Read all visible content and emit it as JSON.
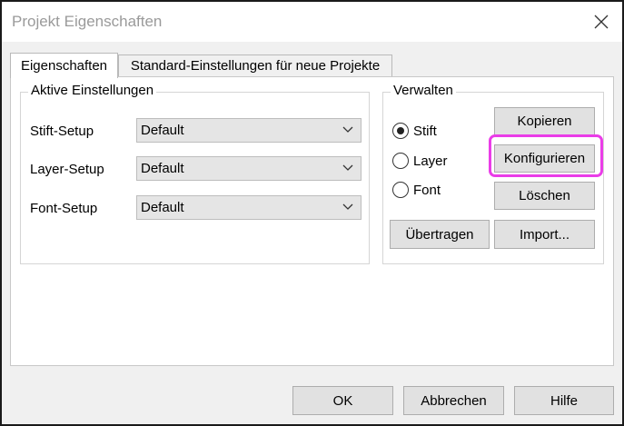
{
  "window": {
    "title": "Projekt Eigenschaften",
    "highlight_color": "#ea3de8"
  },
  "tabs": [
    {
      "label": "Eigenschaften",
      "active": true
    },
    {
      "label": "Standard-Einstellungen für neue Projekte",
      "active": false
    }
  ],
  "active_settings": {
    "title": "Aktive Einstellungen",
    "rows": [
      {
        "label": "Stift-Setup",
        "value": "Default"
      },
      {
        "label": "Layer-Setup",
        "value": "Default"
      },
      {
        "label": "Font-Setup",
        "value": "Default"
      }
    ]
  },
  "manage": {
    "title": "Verwalten",
    "radios": [
      {
        "label": "Stift",
        "selected": true
      },
      {
        "label": "Layer",
        "selected": false
      },
      {
        "label": "Font",
        "selected": false
      }
    ],
    "buttons": {
      "copy": "Kopieren",
      "configure": "Konfigurieren",
      "delete": "Löschen",
      "transfer": "Übertragen",
      "import": "Import..."
    }
  },
  "footer": {
    "ok": "OK",
    "cancel": "Abbrechen",
    "help": "Hilfe"
  }
}
